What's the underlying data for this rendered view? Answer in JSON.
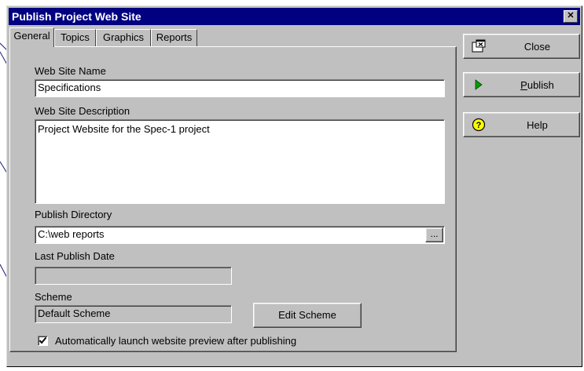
{
  "window": {
    "title": "Publish Project Web Site",
    "close_glyph": "✕"
  },
  "tabs": [
    {
      "label": "General"
    },
    {
      "label": "Topics"
    },
    {
      "label": "Graphics"
    },
    {
      "label": "Reports"
    }
  ],
  "general": {
    "site_name_label": "Web Site Name",
    "site_name_value": "Specifications",
    "description_label": "Web Site Description",
    "description_value": "Project Website for the Spec-1 project",
    "publish_dir_label": "Publish Directory",
    "publish_dir_value": "C:\\web reports",
    "browse_label": "...",
    "last_publish_label": "Last Publish Date",
    "last_publish_value": "",
    "scheme_label": "Scheme",
    "scheme_value": "Default Scheme",
    "edit_scheme_label": "Edit Scheme",
    "auto_launch_label": "Automatically launch website preview after publishing",
    "auto_launch_checked": true
  },
  "side_buttons": {
    "close_label": "Close",
    "publish_label": "Publish",
    "help_label": "Help"
  },
  "colors": {
    "title_bar": "#000080",
    "dialog_face": "#c0c0c0",
    "callout_line": "#000080",
    "publish_icon": "#00a000",
    "help_icon": "#ffff00"
  }
}
